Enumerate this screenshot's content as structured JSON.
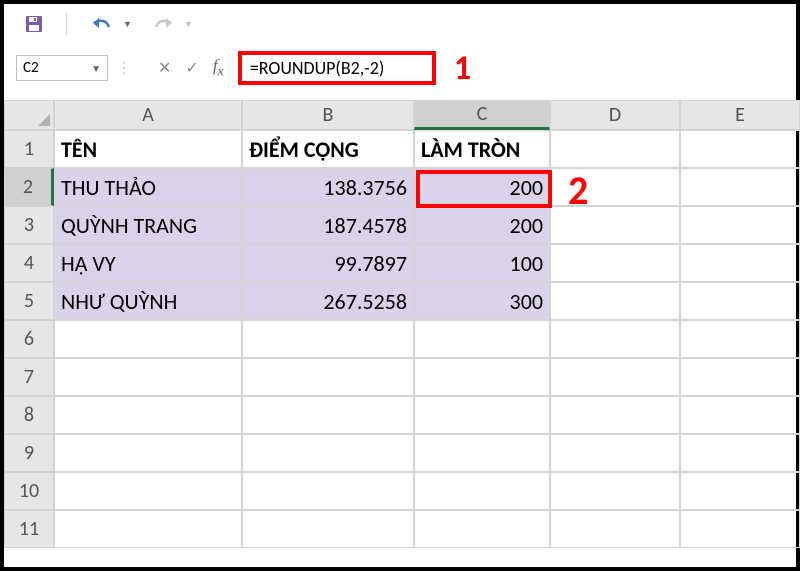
{
  "toolbar": {
    "save_icon": "save-icon",
    "undo_icon": "undo-icon",
    "redo_icon": "redo-icon"
  },
  "namebox": {
    "value": "C2"
  },
  "formula": {
    "value": "=ROUNDUP(B2,-2)"
  },
  "callouts": {
    "one": "1",
    "two": "2"
  },
  "columns": [
    "A",
    "B",
    "C",
    "D",
    "E"
  ],
  "rows": [
    "1",
    "2",
    "3",
    "4",
    "5",
    "6",
    "7",
    "8",
    "9",
    "10",
    "11"
  ],
  "cells": {
    "A1": "TÊN",
    "B1": "ĐIỂM CỘNG",
    "C1": "LÀM TRÒN",
    "A2": "THU THẢO",
    "B2": "138.3756",
    "C2": "200",
    "A3": "QUỲNH TRANG",
    "B3": "187.4578",
    "C3": "200",
    "A4": "HẠ VY",
    "B4": "99.7897",
    "C4": "100",
    "A5": "NHƯ QUỲNH",
    "B5": "267.5258",
    "C5": "300"
  },
  "chart_data": {
    "type": "table",
    "title": "",
    "columns": [
      "TÊN",
      "ĐIỂM CỘNG",
      "LÀM TRÒN"
    ],
    "rows": [
      {
        "TÊN": "THU THẢO",
        "ĐIỂM CỘNG": 138.3756,
        "LÀM TRÒN": 200
      },
      {
        "TÊN": "QUỲNH TRANG",
        "ĐIỂM CỘNG": 187.4578,
        "LÀM TRÒN": 200
      },
      {
        "TÊN": "HẠ VY",
        "ĐIỂM CỘNG": 99.7897,
        "LÀM TRÒN": 100
      },
      {
        "TÊN": "NHƯ QUỲNH",
        "ĐIỂM CỘNG": 267.5258,
        "LÀM TRÒN": 300
      }
    ],
    "formula_C": "=ROUNDUP(B,-2)"
  }
}
